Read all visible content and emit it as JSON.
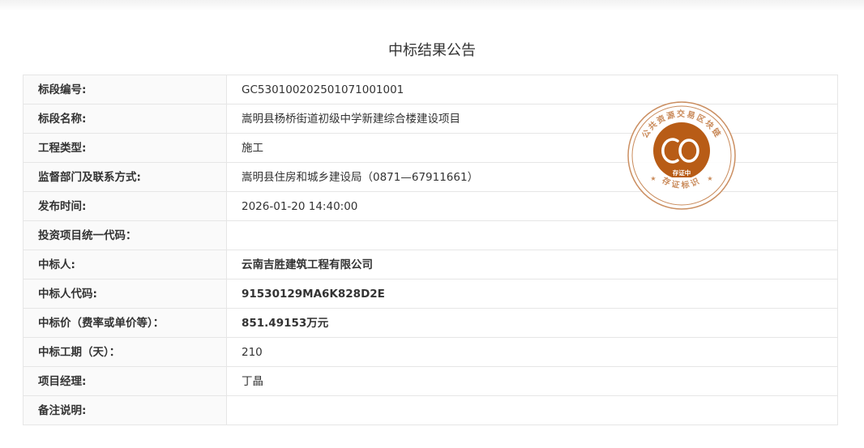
{
  "page": {
    "title": "中标结果公告"
  },
  "rows": [
    {
      "label": "标段编号:",
      "value": "GC5301002025010710010​01",
      "bold": false
    },
    {
      "label": "标段名称:",
      "value": "嵩明县杨桥街道初级中学新建综合楼建设项目",
      "bold": false
    },
    {
      "label": "工程类型:",
      "value": "施工",
      "bold": false
    },
    {
      "label": "监督部门及联系方式:",
      "value": "嵩明县住房和城乡建设局（0871—67911661）",
      "bold": false
    },
    {
      "label": "发布时间:",
      "value": "2026-01-20 14:40:00",
      "bold": false
    },
    {
      "label": "投资项目统一代码：",
      "value": "",
      "bold": false
    },
    {
      "label": "中标人:",
      "value": "云南吉胜建筑工程有限公司",
      "bold": true
    },
    {
      "label": "中标人代码:",
      "value": "91530129MA6K828D2E",
      "bold": true
    },
    {
      "label": "中标价（费率或单价等）：",
      "value": "851.49153万元",
      "bold": true
    },
    {
      "label": "中标工期（天）：",
      "value": "210",
      "bold": false
    },
    {
      "label": "项目经理:",
      "value": "丁晶",
      "bold": false
    },
    {
      "label": "备注说明:",
      "value": "",
      "bold": false
    }
  ],
  "stamp": {
    "top_text": "公共资源交易区块链",
    "center_text": "存证中",
    "bottom_text": "存证标识",
    "color": "#b85c16"
  }
}
